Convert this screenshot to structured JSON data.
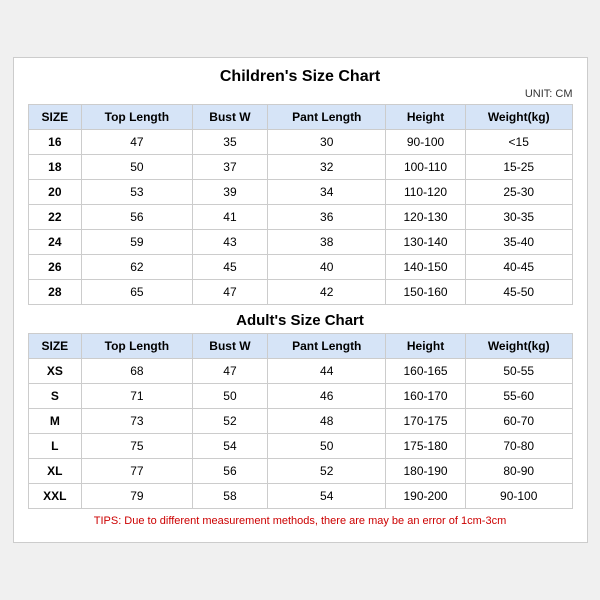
{
  "mainTitle": "Children's Size Chart",
  "unit": "UNIT: CM",
  "childHeaders": [
    "SIZE",
    "Top Length",
    "Bust W",
    "Pant Length",
    "Height",
    "Weight(kg)"
  ],
  "childRows": [
    [
      "16",
      "47",
      "35",
      "30",
      "90-100",
      "<15"
    ],
    [
      "18",
      "50",
      "37",
      "32",
      "100-110",
      "15-25"
    ],
    [
      "20",
      "53",
      "39",
      "34",
      "110-120",
      "25-30"
    ],
    [
      "22",
      "56",
      "41",
      "36",
      "120-130",
      "30-35"
    ],
    [
      "24",
      "59",
      "43",
      "38",
      "130-140",
      "35-40"
    ],
    [
      "26",
      "62",
      "45",
      "40",
      "140-150",
      "40-45"
    ],
    [
      "28",
      "65",
      "47",
      "42",
      "150-160",
      "45-50"
    ]
  ],
  "adultTitle": "Adult's Size Chart",
  "adultHeaders": [
    "SIZE",
    "Top Length",
    "Bust W",
    "Pant Length",
    "Height",
    "Weight(kg)"
  ],
  "adultRows": [
    [
      "XS",
      "68",
      "47",
      "44",
      "160-165",
      "50-55"
    ],
    [
      "S",
      "71",
      "50",
      "46",
      "160-170",
      "55-60"
    ],
    [
      "M",
      "73",
      "52",
      "48",
      "170-175",
      "60-70"
    ],
    [
      "L",
      "75",
      "54",
      "50",
      "175-180",
      "70-80"
    ],
    [
      "XL",
      "77",
      "56",
      "52",
      "180-190",
      "80-90"
    ],
    [
      "XXL",
      "79",
      "58",
      "54",
      "190-200",
      "90-100"
    ]
  ],
  "tips": "TIPS: Due to different measurement methods, there are may be an error of 1cm-3cm"
}
